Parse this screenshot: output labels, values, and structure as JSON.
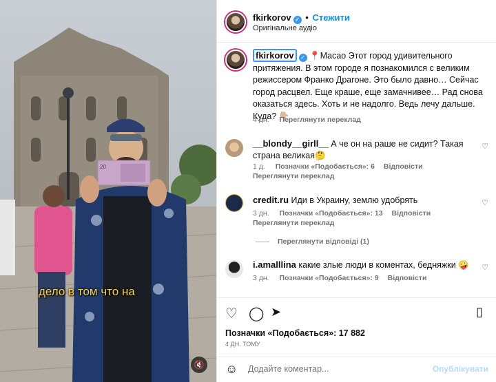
{
  "media": {
    "subtitle": "дело в том что на",
    "banknote_value": "20"
  },
  "header": {
    "username": "fkirkorov",
    "follow_label": "Стежити",
    "audio_label": "Оригінальне аудіо",
    "separator": "•"
  },
  "post": {
    "username": "fkirkorov",
    "location": "Macao",
    "text": "Этот город удивительного притяжения. В этом городе я познакомился с великим режиссером Франко Драгоне. Это было давно… Сейчас город расцвел. Еще краше, еще замачнивее… Рад снова оказаться здесь. Хоть и не надолго. Ведь лечу дальше. Куда? 👇🏼",
    "time": "4 дн.",
    "translate": "Переглянути переклад"
  },
  "comments": [
    {
      "username": "__blondy__girll__",
      "text": "А че он на раше не сидит? Такая страна великая🤔",
      "time": "1 д.",
      "likes": "Позначки «Подобається»: 6",
      "reply": "Відповісти",
      "translate": "Переглянути переклад"
    },
    {
      "username": "credit.ru",
      "text": "Иди в Украину, землю удобрять",
      "time": "3 дн.",
      "likes": "Позначки «Подобається»: 13",
      "reply": "Відповісти",
      "translate": "Переглянути переклад"
    },
    {
      "username": "i.amalllina",
      "text": "какие злые люди в коментах, бедняжки 🤪",
      "time": "3 дн.",
      "likes": "Позначки «Подобається»: 9",
      "reply": "Відповісти"
    }
  ],
  "view_replies": "Переглянути відповіді (1)",
  "actions": {
    "likes": "Позначки «Подобається»: 17 882",
    "date": "4 ДН. ТОМУ"
  },
  "add_comment": {
    "placeholder": "Додайте коментар...",
    "publish": "Опублікувати"
  },
  "colors": {
    "accent": "#0095f6",
    "meta": "#737373",
    "location_pin": "#e0245e"
  }
}
